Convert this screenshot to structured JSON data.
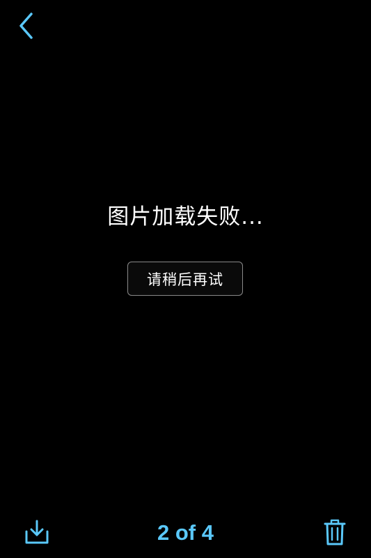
{
  "nav": {
    "back_icon": "chevron-left-icon"
  },
  "error": {
    "message": "图片加载失败...",
    "retry_label": "请稍后再试"
  },
  "toolbar": {
    "download_icon": "download-icon",
    "page_counter": "2 of 4",
    "delete_icon": "trash-icon"
  },
  "colors": {
    "background": "#000000",
    "accent": "#5ac8fa",
    "text": "#ffffff",
    "button_border": "#8a8a8a"
  }
}
